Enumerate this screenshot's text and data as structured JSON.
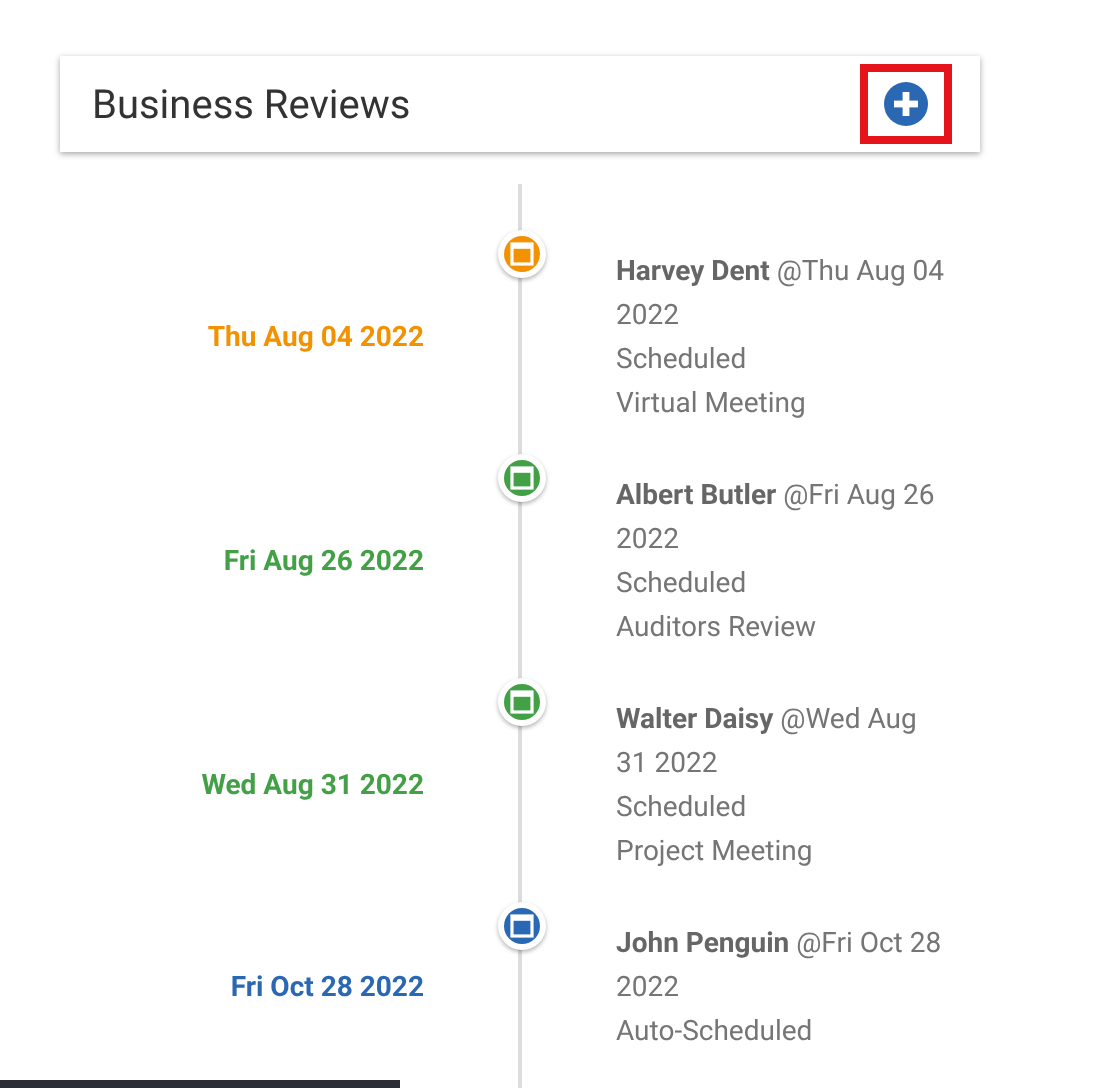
{
  "header": {
    "title": "Business Reviews",
    "add_button_highlighted": true
  },
  "events": [
    {
      "date": "Thu Aug 04 2022",
      "color": "#f39200",
      "heading": "**Harvey Dent** @Thu Aug 04 2022",
      "lines": [
        "Scheduled",
        "Virtual Meeting"
      ]
    },
    {
      "date": "Fri Aug 26 2022",
      "color": "#43a047",
      "heading": "**Albert Butler** @Fri Aug 26 2022",
      "lines": [
        "Scheduled",
        "Auditors Review"
      ]
    },
    {
      "date": "Wed Aug 31 2022",
      "color": "#43a047",
      "heading": "**Walter Daisy** @Wed Aug 31 2022",
      "lines": [
        "Scheduled",
        "Project Meeting"
      ]
    },
    {
      "date": "Fri Oct 28 2022",
      "color": "#2a68b4",
      "heading": "**John Penguin** @Fri Oct 28 2022",
      "lines": [
        "Auto-Scheduled"
      ]
    }
  ]
}
